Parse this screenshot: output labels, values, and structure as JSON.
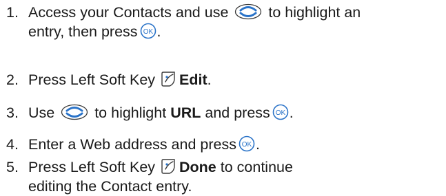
{
  "steps": [
    {
      "number": "1.",
      "text_a": "Access your Contacts and use",
      "text_b": "to highlight an",
      "text_c": "entry, then press",
      "text_d": "."
    },
    {
      "number": "2.",
      "text_a": "Press Left Soft Key",
      "bold": "Edit",
      "text_b": "."
    },
    {
      "number": "3.",
      "text_a": "Use",
      "text_b": "to highlight",
      "bold": "URL",
      "text_c": "and press",
      "text_d": "."
    },
    {
      "number": "4.",
      "text_a": "Enter a Web address and press",
      "text_b": "."
    },
    {
      "number": "5.",
      "text_a": "Press Left Soft Key",
      "bold": "Done",
      "text_b": "to continue",
      "text_c": "editing the Contact entry."
    }
  ],
  "icons": {
    "nav": "nav-key-icon",
    "ok": "ok-key-icon",
    "softkey": "left-softkey-icon",
    "ok_label": "OK",
    "accent": "#2a73c8"
  }
}
